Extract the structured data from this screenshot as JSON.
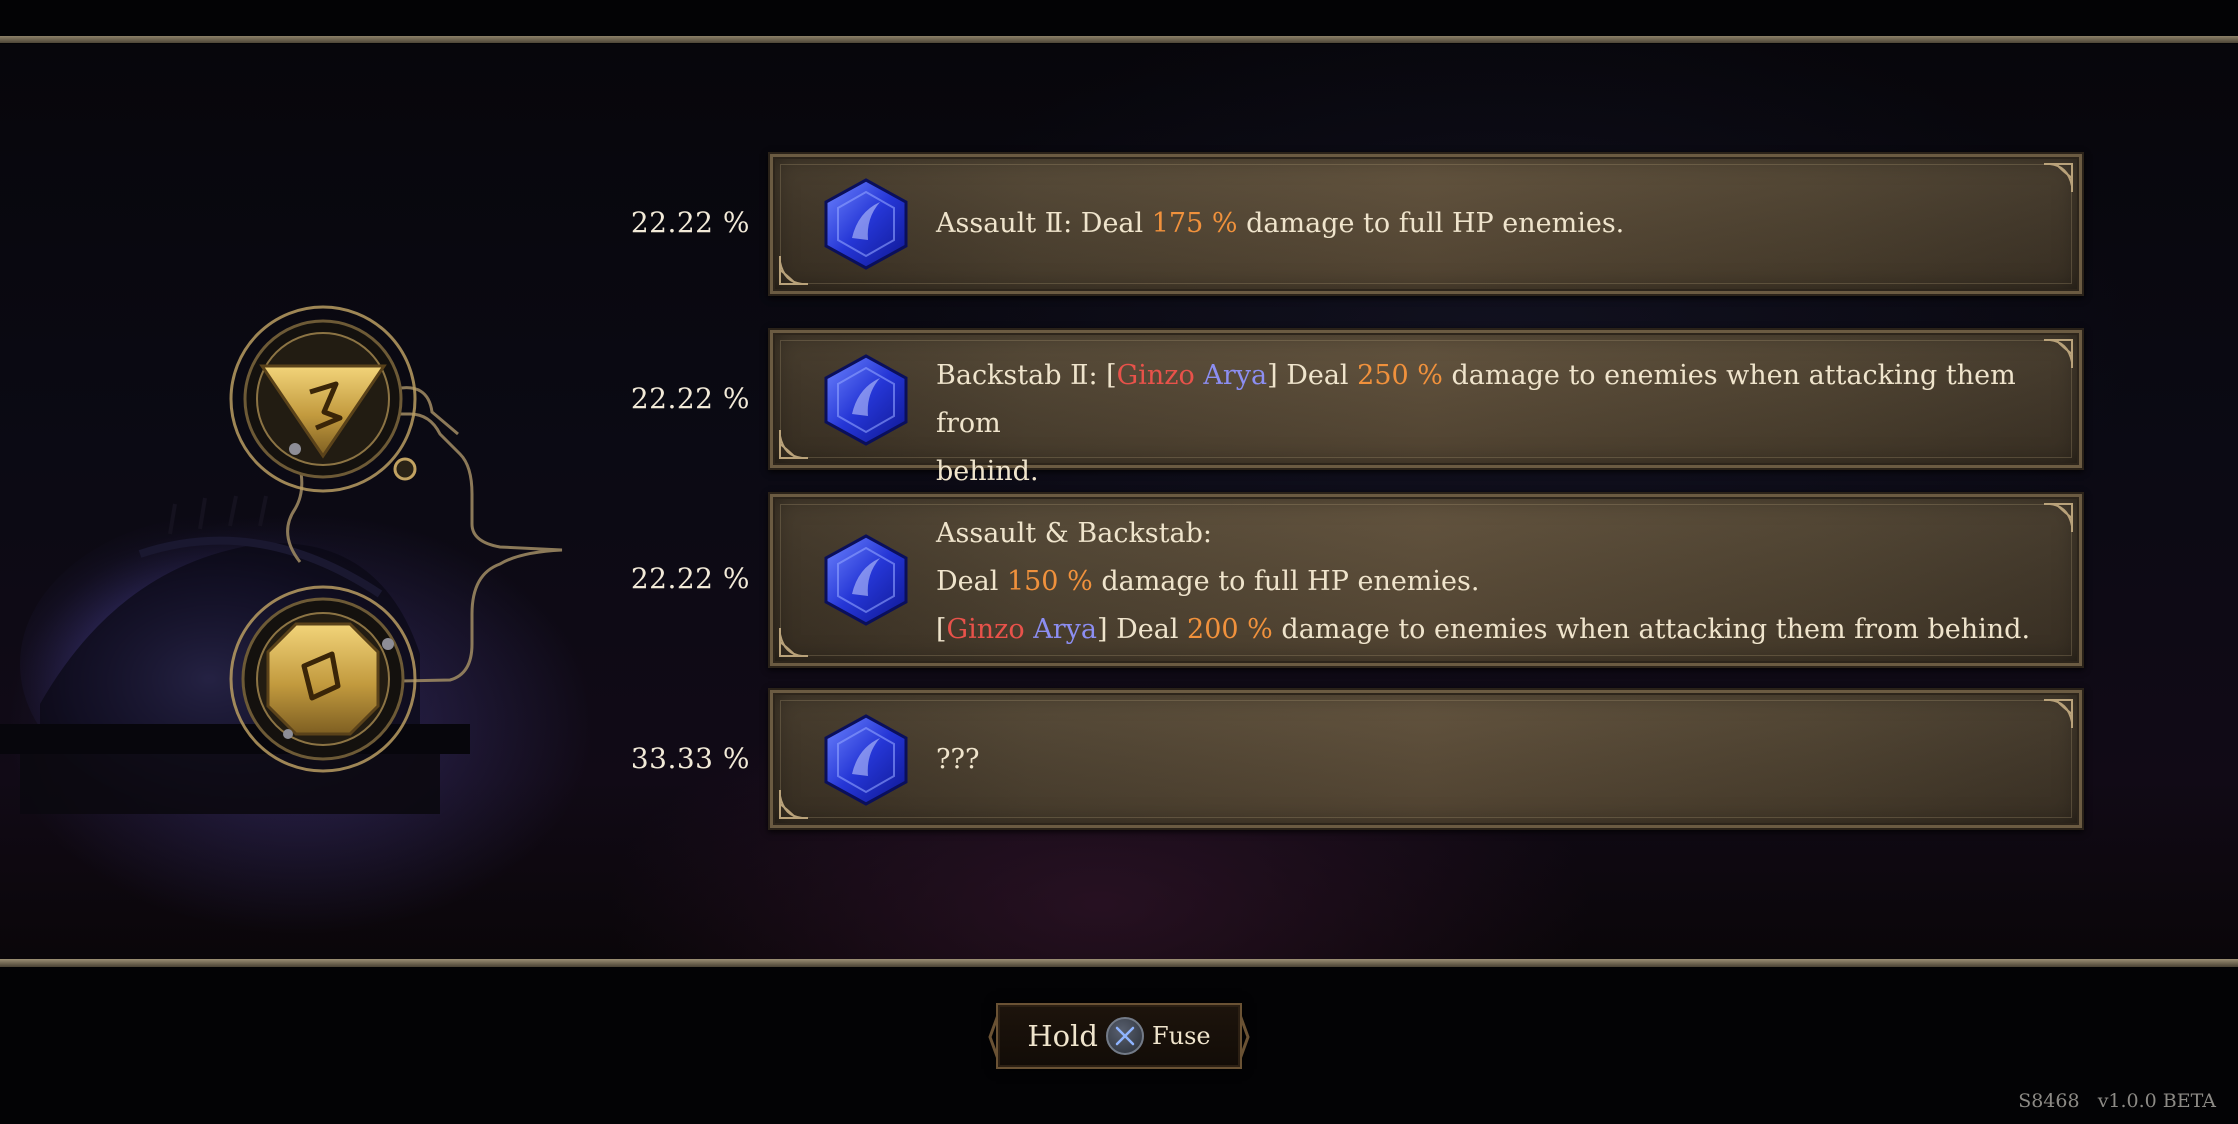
{
  "rows": [
    {
      "percent": "22.22 %",
      "lines": [
        [
          {
            "t": "Assault Ⅱ: Deal "
          },
          {
            "t": "175 %",
            "c": "hl"
          },
          {
            "t": " damage to full HP enemies."
          }
        ]
      ]
    },
    {
      "percent": "22.22 %",
      "lines": [
        [
          {
            "t": "Backstab Ⅱ: ["
          },
          {
            "t": "Ginzo",
            "c": "red"
          },
          {
            "t": " "
          },
          {
            "t": "Arya",
            "c": "blue"
          },
          {
            "t": "] Deal "
          },
          {
            "t": "250 %",
            "c": "hl"
          },
          {
            "t": " damage to enemies when attacking them from"
          }
        ],
        [
          {
            "t": "behind."
          }
        ]
      ]
    },
    {
      "percent": "22.22 %",
      "lines": [
        [
          {
            "t": "Assault & Backstab:"
          }
        ],
        [
          {
            "t": "Deal "
          },
          {
            "t": "150 %",
            "c": "hl"
          },
          {
            "t": " damage to full HP enemies."
          }
        ],
        [
          {
            "t": "["
          },
          {
            "t": "Ginzo",
            "c": "red"
          },
          {
            "t": " "
          },
          {
            "t": "Arya",
            "c": "blue"
          },
          {
            "t": "] Deal "
          },
          {
            "t": "200 %",
            "c": "hl"
          },
          {
            "t": " damage to enemies when attacking them from behind."
          }
        ]
      ]
    },
    {
      "percent": "33.33 %",
      "lines": [
        [
          {
            "t": "???"
          }
        ]
      ]
    }
  ],
  "prompt": {
    "hold": "Hold",
    "button_icon": "cross-button-icon",
    "action": "Fuse"
  },
  "footer": {
    "build": "S8468",
    "version": "v1.0.0 BETA"
  },
  "colors": {
    "highlight": "#f0913c",
    "red_name": "#e8524a",
    "blue_name": "#8c8ef2",
    "text": "#efe4cc",
    "panel": "#4d4130",
    "gem": "#2a3de0",
    "gold": "#c9a44a"
  },
  "icons": {
    "row_gem": "blue-gem-icon",
    "rune_top": "gold-triangle-rune-icon",
    "rune_bottom": "gold-octagon-rune-icon"
  }
}
